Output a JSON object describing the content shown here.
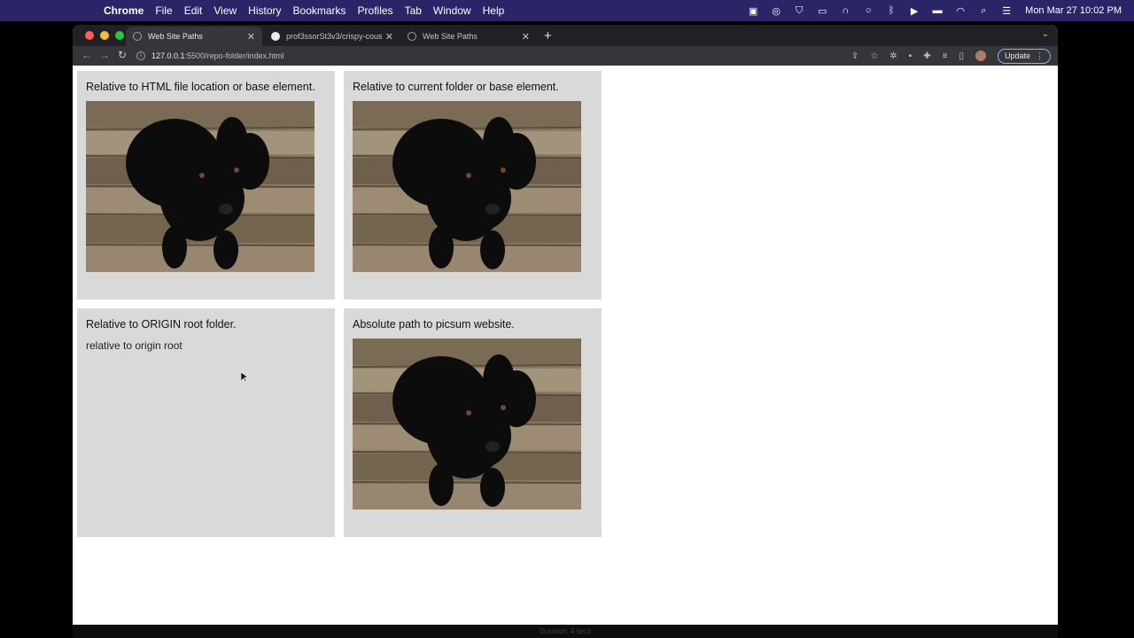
{
  "menubar": {
    "app": "Chrome",
    "items": [
      "File",
      "Edit",
      "View",
      "History",
      "Bookmarks",
      "Profiles",
      "Tab",
      "Window",
      "Help"
    ],
    "clock": "Mon Mar 27  10:02 PM"
  },
  "tabs": [
    {
      "title": "Web Site Paths",
      "active": true
    },
    {
      "title": "prof3ssorSt3v3/crispy-couscous",
      "active": false
    },
    {
      "title": "Web Site Paths",
      "active": false
    }
  ],
  "toolbar": {
    "url_host": "127.0.0.1",
    "url_path": ":5500/repo-folder/index.html",
    "update_label": "Update"
  },
  "cards": [
    {
      "caption": "Relative to HTML file location or base element."
    },
    {
      "caption": "Relative to current folder or base element."
    },
    {
      "caption": "Relative to ORIGIN root folder.",
      "broken_alt": "relative to origin root"
    },
    {
      "caption": "Absolute path to picsum website."
    }
  ],
  "dock": {
    "hint": "Duration: 4 secs"
  }
}
